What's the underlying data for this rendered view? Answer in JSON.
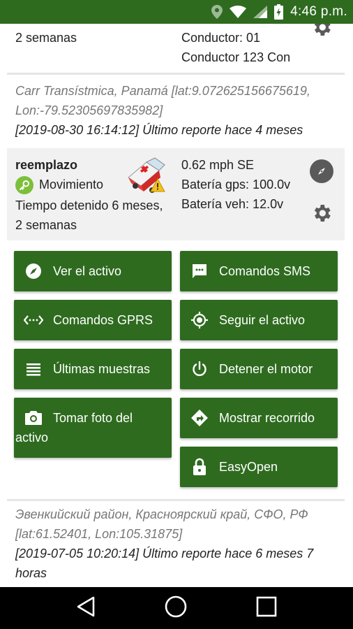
{
  "status": {
    "time": "4:46 p.m."
  },
  "top_card": {
    "duration_tail": "2 semanas",
    "driver_line1": "Conductor: 01",
    "driver_line2": "Conductor 123 Con",
    "address_line1": "Carr Transístmica, Panamá [lat:9.072625156675619,",
    "address_line2": "Lon:-79.52305697835982]",
    "report": "[2019-08-30 16:14:12] Último reporte hace 4 meses"
  },
  "asset": {
    "name": "reemplazo",
    "status_label": "Movimiento",
    "stopped_line1": "Tiempo detenido 6 meses,",
    "stopped_line2": "2 semanas",
    "speed": "0.62 mph SE",
    "gps_battery": "Batería gps: 100.0v",
    "vehicle_battery": "Batería veh: 12.0v"
  },
  "actions": {
    "view_asset": "Ver el activo",
    "sms_commands": "Comandos SMS",
    "gprs_commands": "Comandos GPRS",
    "follow_asset": "Seguir el activo",
    "latest_samples": "Últimas muestras",
    "stop_engine": "Detener el motor",
    "take_photo_line1": "Tomar foto del",
    "take_photo_line2": "activo",
    "show_route": "Mostrar recorrido",
    "easyopen": "EasyOpen"
  },
  "bottom_card": {
    "address_line1": "Эвенкийский район, Красноярский край, СФО, РФ",
    "address_line2": "[lat:61.52401, Lon:105.31875]",
    "report_line1": "[2019-07-05 10:20:14] Último reporte hace 6 meses 7",
    "report_line2": "horas"
  },
  "colors": {
    "primary_green": "#2e6b1f",
    "icon_gray": "#5a5a5a",
    "card_gray": "#f1f1f1"
  }
}
